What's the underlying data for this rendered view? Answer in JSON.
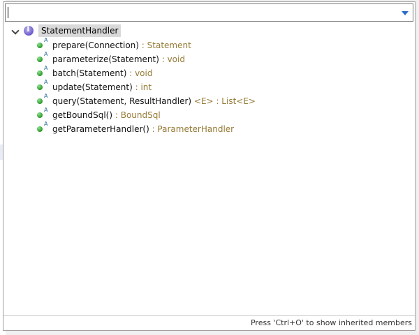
{
  "filter": {
    "value": "",
    "placeholder": ""
  },
  "tree": {
    "root": {
      "label": "StatementHandler",
      "icon": "interface-icon",
      "expanded": true
    },
    "members": [
      {
        "signature": "prepare(Connection)",
        "generic": "",
        "return_type": " : Statement"
      },
      {
        "signature": "parameterize(Statement)",
        "generic": "",
        "return_type": " : void"
      },
      {
        "signature": "batch(Statement)",
        "generic": "",
        "return_type": " : void"
      },
      {
        "signature": "update(Statement)",
        "generic": "",
        "return_type": " : int"
      },
      {
        "signature": "query(Statement, ResultHandler)",
        "generic": " <E>",
        "return_type": " : List<E>"
      },
      {
        "signature": "getBoundSql()",
        "generic": "",
        "return_type": " : BoundSql"
      },
      {
        "signature": "getParameterHandler()",
        "generic": "",
        "return_type": " : ParameterHandler"
      }
    ]
  },
  "status": {
    "hint": "Press 'Ctrl+O' to show inherited members"
  },
  "colors": {
    "return_type": "#957a35",
    "method_public": "#2e9e2e",
    "interface": "#6a5acd",
    "dropdown_arrow": "#2a6cc4"
  }
}
